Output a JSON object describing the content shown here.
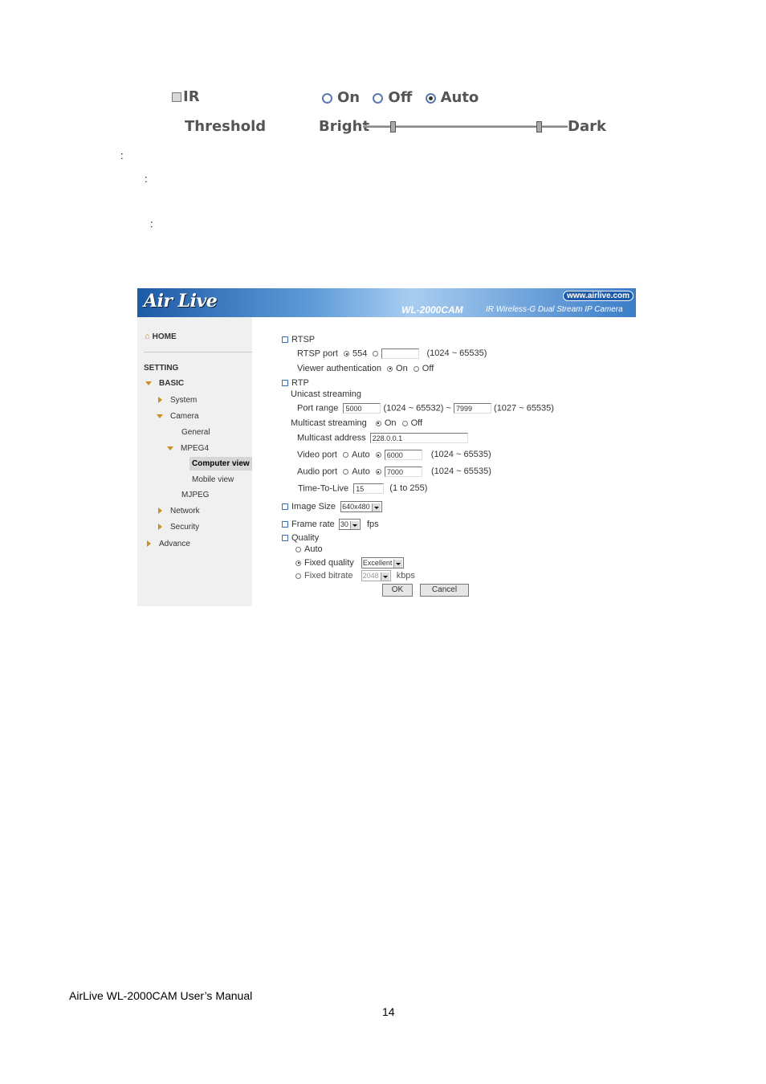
{
  "ir_panel": {
    "ir_label": "IR",
    "options": [
      "On",
      "Off",
      "Auto"
    ],
    "selected": "Auto",
    "threshold_label": "Threshold",
    "bright_label": "Bright",
    "dark_label": "Dark"
  },
  "colons": [
    ":",
    ":",
    ":"
  ],
  "screenshot": {
    "logo": "Air Live",
    "website": "www.airlive.com",
    "model": "WL-2000CAM",
    "subtitle": "IR Wireless-G Dual Stream IP Camera",
    "sidebar": {
      "home": "HOME",
      "setting": "SETTING",
      "basic": "BASIC",
      "system": "System",
      "camera": "Camera",
      "general": "General",
      "mpeg4": "MPEG4",
      "computer_view": "Computer view",
      "mobile_view": "Mobile view",
      "mjpeg": "MJPEG",
      "network": "Network",
      "security": "Security",
      "advance": "Advance"
    },
    "form": {
      "rtsp_heading": "RTSP",
      "rtsp_port_label": "RTSP port",
      "rtsp_port_default": "554",
      "rtsp_port_custom": "",
      "rtsp_port_range": "(1024 ~ 65535)",
      "viewer_auth_label": "Viewer authentication",
      "on": "On",
      "off": "Off",
      "rtp_heading": "RTP",
      "unicast_label": "Unicast streaming",
      "port_range_label": "Port range",
      "port_from": "5000",
      "port_from_range": "(1024 ~ 65532) ~",
      "port_to": "7999",
      "port_to_range": "(1027 ~ 65535)",
      "multicast_label": "Multicast streaming",
      "multicast_address_label": "Multicast address",
      "multicast_address": "228.0.0.1",
      "video_port_label": "Video port",
      "auto": "Auto",
      "video_port": "6000",
      "video_port_range": "(1024 ~ 65535)",
      "audio_port_label": "Audio port",
      "audio_port": "7000",
      "audio_port_range": "(1024 ~ 65535)",
      "ttl_label": "Time-To-Live",
      "ttl_value": "15",
      "ttl_range": "(1 to 255)",
      "image_size_label": "Image Size",
      "image_size": "640x480",
      "frame_rate_label": "Frame rate",
      "frame_rate": "30",
      "fps": "fps",
      "quality_heading": "Quality",
      "quality_auto": "Auto",
      "fixed_quality_label": "Fixed quality",
      "fixed_quality": "Excellent",
      "fixed_bitrate_label": "Fixed bitrate",
      "fixed_bitrate": "2048",
      "kbps": "kbps",
      "ok": "OK",
      "cancel": "Cancel"
    }
  },
  "footer": {
    "manual": "AirLive WL-2000CAM User’s Manual",
    "page": "14"
  }
}
